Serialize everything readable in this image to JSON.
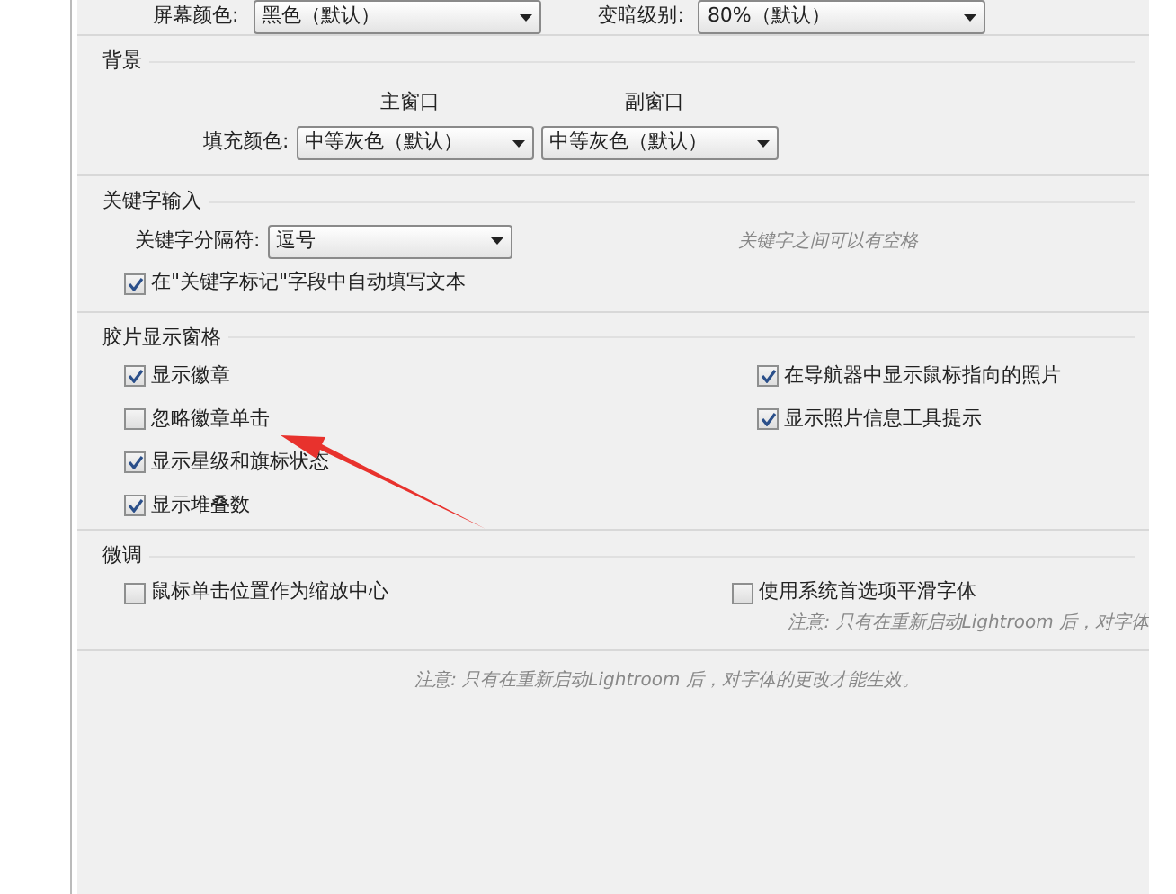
{
  "top_row": [
    {
      "label": "屏幕颜色:",
      "value": "黑色（默认）"
    },
    {
      "label": "变暗级别:",
      "value": "80%（默认）"
    }
  ],
  "background": {
    "title": "背景",
    "columns": [
      "主窗口",
      "副窗口"
    ],
    "row_label": "填充颜色:",
    "dropdowns": [
      "中等灰色（默认）",
      "中等灰色（默认）"
    ]
  },
  "keywords": {
    "title": "关键字输入",
    "separator_label": "关键字分隔符:",
    "separator_value": "逗号",
    "hint": "关键字之间可以有空格",
    "autofill": {
      "label": "在\"关键字标记\"字段中自动填写文本",
      "checked": true
    }
  },
  "filmstrip": {
    "title": "胶片显示窗格",
    "left": [
      {
        "label": "显示徽章",
        "checked": true
      },
      {
        "label": "忽略徽章单击",
        "checked": false
      },
      {
        "label": "显示星级和旗标状态",
        "checked": true
      },
      {
        "label": "显示堆叠数",
        "checked": true
      }
    ],
    "right": [
      {
        "label": "在导航器中显示鼠标指向的照片",
        "checked": true
      },
      {
        "label": "显示照片信息工具提示",
        "checked": true
      }
    ]
  },
  "tweaks": {
    "title": "微调",
    "options": [
      {
        "label": "鼠标单击位置作为缩放中心",
        "checked": false
      },
      {
        "label": "使用系统首选项平滑字体",
        "checked": false
      }
    ],
    "note": "注意: 只有在重新启动Lightroom 后，对字体"
  },
  "footer_note": "注意: 只有在重新启动Lightroom 后，对字体的更改才能生效。"
}
